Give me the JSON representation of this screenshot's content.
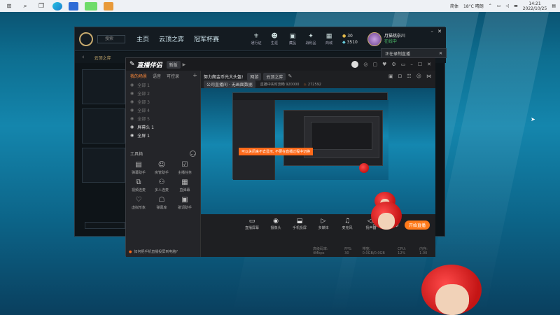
{
  "taskbar": {
    "apps": [
      "edge",
      "file-app",
      "live-app",
      "chat-app"
    ],
    "tray": {
      "lang": "简体",
      "weather": "18°C  晴朗",
      "time": "14:21",
      "date": "2022/10/25"
    }
  },
  "game": {
    "search_placeholder": "搜索",
    "nav": [
      "主页",
      "云顶之弈",
      "冠军杯赛"
    ],
    "icons": [
      "通行证",
      "生涯",
      "藏品",
      "战利品",
      "商城"
    ],
    "currency_a": "30",
    "currency_b": "3510",
    "username": "月猫桃奈川",
    "user_status": "在线中",
    "level": "278",
    "tab_label": "云顶之弈  "
  },
  "tooltip": {
    "text": "正在录制直播"
  },
  "recorder": {
    "title": "直播伴侣",
    "badge": "新版",
    "stream_title": "努力爬金币光大头盔!",
    "category": "网游",
    "category_tag": "云顶之弈",
    "status_pill": "公司直播间 · 无画面数据",
    "status_text": "直播中实时流畅 920000",
    "viewers": "272592",
    "left_tabs": [
      "我的场景",
      "语音",
      "可控录"
    ],
    "scenes": [
      "全部 1",
      "全部 2",
      "全部 3",
      "全部 4",
      "全部 5",
      "屏幕头 1",
      "全屏 1"
    ],
    "tool_section": "工具箱",
    "tools": [
      "弹幕助手",
      "房管助手",
      "主播任务",
      "视频连麦",
      "多人连麦",
      "直弹幕",
      "虚拟形象",
      "弹幕库",
      "歌词助手"
    ],
    "bottom_tip": "如何把手机直播投屏到电脑?",
    "bottom_btns": [
      "直播屏幕",
      "摄像头",
      "手机投屏",
      "多媒体",
      "麦克风",
      "扬声器"
    ],
    "start_button": "开始直播",
    "footer": [
      "高级码率: 4Mbps",
      "FPS: 30",
      "带宽: 0.0GB/0.0GB",
      "CPU: 12%",
      "内存: 1.00"
    ],
    "toast": "可以关闭来不去显示, 不要在直播过程中切换"
  }
}
